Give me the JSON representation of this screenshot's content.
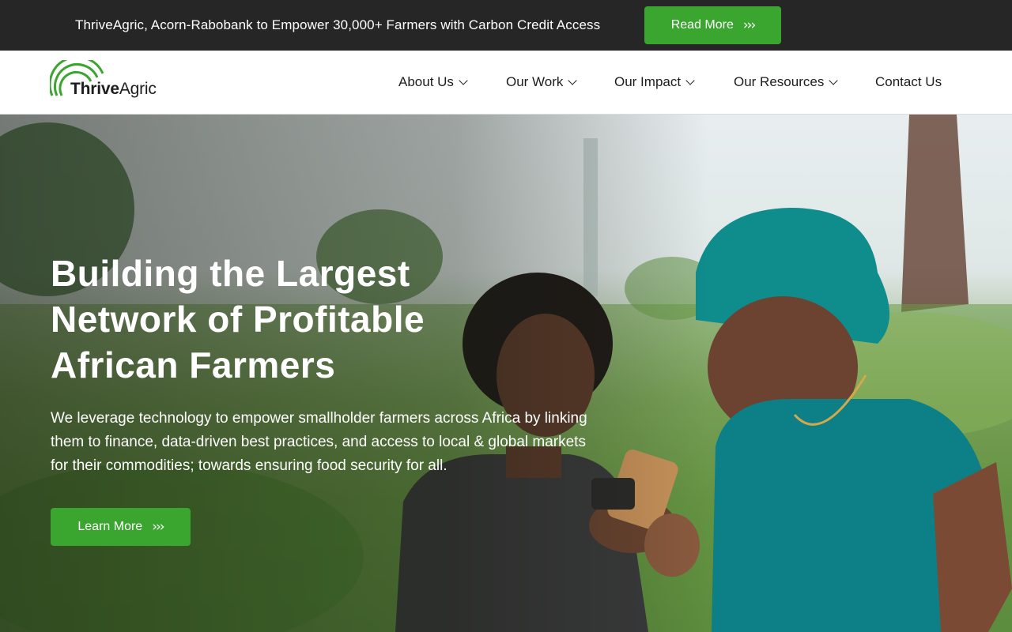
{
  "announcement": {
    "text": "ThriveAgric, Acorn-Rabobank to Empower 30,000+ Farmers with Carbon Credit Access",
    "button_label": "Read More",
    "button_icon": "chevrons-right-icon"
  },
  "header": {
    "logo": {
      "brand_bold": "Thrive",
      "brand_regular": "Agric",
      "mark_color": "#3aa62f"
    },
    "nav": [
      {
        "label": "About Us",
        "has_dropdown": true
      },
      {
        "label": "Our Work",
        "has_dropdown": true
      },
      {
        "label": "Our Impact",
        "has_dropdown": true
      },
      {
        "label": "Our Resources",
        "has_dropdown": true
      },
      {
        "label": "Contact Us",
        "has_dropdown": false
      }
    ]
  },
  "hero": {
    "title": "Building the Largest Network of Profitable African Farmers",
    "description": "We leverage technology to empower smallholder farmers across Africa by linking them to finance, data-driven best practices, and access to local & global markets for their commodities; towards ensuring food security for all.",
    "button_label": "Learn More",
    "button_icon": "chevrons-right-icon"
  },
  "colors": {
    "accent": "#3aa62f",
    "announcement_bg": "#262626",
    "header_bg": "#ffffff",
    "text_dark": "#1d1d1d"
  },
  "chevrons": "›››"
}
